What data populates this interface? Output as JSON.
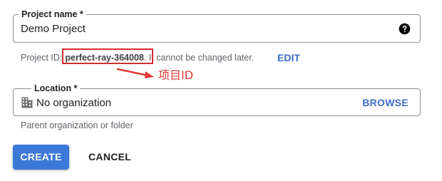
{
  "project_name": {
    "label": "Project name *",
    "value": "Demo Project",
    "help_icon": "help-circle-icon"
  },
  "project_id": {
    "prefix": "Project ID:",
    "value": "perfect-ray-364008",
    "suffix": ". It cannot be changed later.",
    "edit_label": "EDIT"
  },
  "annotation": {
    "text": "项目ID",
    "color": "#e53935"
  },
  "location": {
    "label": "Location *",
    "value": "No organization",
    "icon": "building-icon",
    "browse_label": "BROWSE",
    "helper": "Parent organization or folder"
  },
  "actions": {
    "create_label": "CREATE",
    "cancel_label": "CANCEL"
  },
  "colors": {
    "primary": "#3c78d8",
    "link": "#3c6ec9",
    "annotation_red": "#d32f2f"
  }
}
